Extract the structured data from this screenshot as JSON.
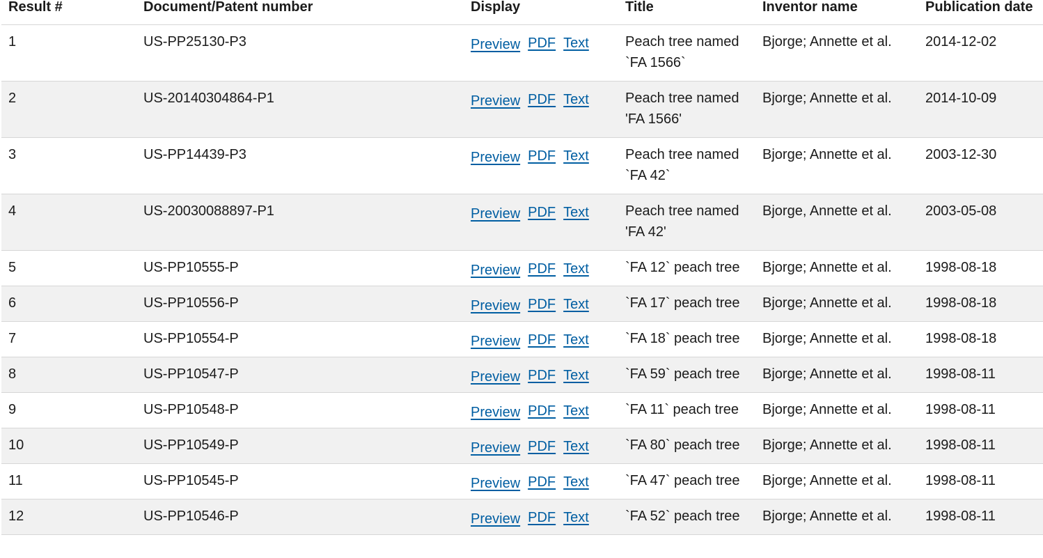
{
  "table": {
    "headers": {
      "result": "Result #",
      "document": "Document/Patent number",
      "display": "Display",
      "title": "Title",
      "inventor": "Inventor name",
      "date": "Publication date"
    },
    "link_labels": {
      "preview": "Preview",
      "pdf": "PDF",
      "text": "Text"
    },
    "link_color": "#005ea2",
    "rows": [
      {
        "result": "1",
        "document": "US-PP25130-P3",
        "title": "Peach tree named `FA 1566`",
        "inventor": "Bjorge; Annette et al.",
        "date": "2014-12-02"
      },
      {
        "result": "2",
        "document": "US-20140304864-P1",
        "title": "Peach tree named 'FA 1566'",
        "inventor": "Bjorge; Annette et al.",
        "date": "2014-10-09"
      },
      {
        "result": "3",
        "document": "US-PP14439-P3",
        "title": "Peach tree named `FA 42`",
        "inventor": "Bjorge; Annette et al.",
        "date": "2003-12-30"
      },
      {
        "result": "4",
        "document": "US-20030088897-P1",
        "title": "Peach tree named 'FA 42'",
        "inventor": "Bjorge, Annette et al.",
        "date": "2003-05-08"
      },
      {
        "result": "5",
        "document": "US-PP10555-P",
        "title": "`FA 12` peach tree",
        "inventor": "Bjorge; Annette et al.",
        "date": "1998-08-18"
      },
      {
        "result": "6",
        "document": "US-PP10556-P",
        "title": "`FA 17` peach tree",
        "inventor": "Bjorge; Annette et al.",
        "date": "1998-08-18"
      },
      {
        "result": "7",
        "document": "US-PP10554-P",
        "title": "`FA 18` peach tree",
        "inventor": "Bjorge; Annette et al.",
        "date": "1998-08-18"
      },
      {
        "result": "8",
        "document": "US-PP10547-P",
        "title": "`FA 59` peach tree",
        "inventor": "Bjorge; Annette et al.",
        "date": "1998-08-11"
      },
      {
        "result": "9",
        "document": "US-PP10548-P",
        "title": "`FA 11` peach tree",
        "inventor": "Bjorge; Annette et al.",
        "date": "1998-08-11"
      },
      {
        "result": "10",
        "document": "US-PP10549-P",
        "title": "`FA 80` peach tree",
        "inventor": "Bjorge; Annette et al.",
        "date": "1998-08-11"
      },
      {
        "result": "11",
        "document": "US-PP10545-P",
        "title": "`FA 47` peach tree",
        "inventor": "Bjorge; Annette et al.",
        "date": "1998-08-11"
      },
      {
        "result": "12",
        "document": "US-PP10546-P",
        "title": "`FA 52` peach tree",
        "inventor": "Bjorge; Annette et al.",
        "date": "1998-08-11"
      }
    ]
  }
}
